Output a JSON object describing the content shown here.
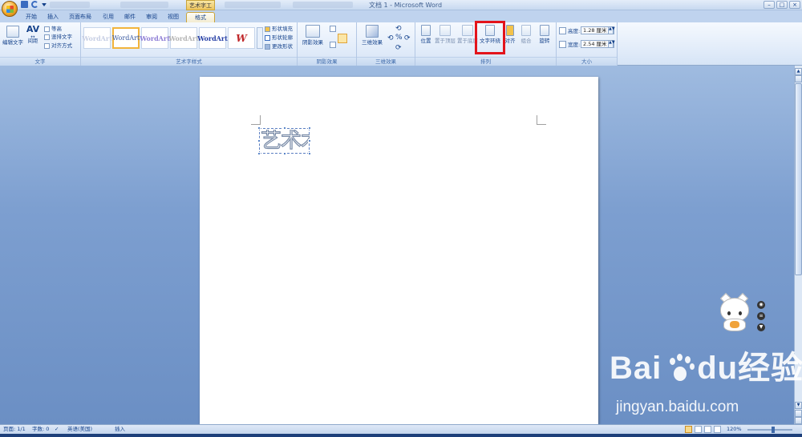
{
  "window": {
    "title": "文档 1 - Microsoft Word",
    "context_tool": "艺术字工具",
    "controls": [
      "–",
      "□",
      "×"
    ]
  },
  "tabs": [
    "开始",
    "插入",
    "页面布局",
    "引用",
    "邮件",
    "审阅",
    "视图",
    "格式"
  ],
  "active_tab": "格式",
  "ribbon": {
    "text_group": {
      "label": "文字",
      "edit_text": "编辑文字",
      "spacing": "间距",
      "equal_height": "等高",
      "vertical_text": "竖排文字",
      "align": "对齐方式"
    },
    "wordart_styles_group": {
      "label": "艺术字样式",
      "gallery": [
        {
          "text": "WordArt",
          "color": "#c7cfe4"
        },
        {
          "text": "WordArt",
          "color": "#3a5aa0"
        },
        {
          "text": "WordArt",
          "color": "#8f7fd6"
        },
        {
          "text": "WordArt",
          "color": "#b5b5b5"
        },
        {
          "text": "WordArt",
          "color": "#2740a6"
        },
        {
          "text": "W",
          "color": "#c0282a"
        }
      ],
      "shape_fill": "形状填充",
      "shape_outline": "形状轮廓",
      "change_shape": "更改形状"
    },
    "shadow_group": {
      "label": "阴影效果",
      "shadow_effect": "阴影效果"
    },
    "threed_group": {
      "label": "三维效果",
      "threed_effect": "三维效果"
    },
    "arrange_group": {
      "label": "排列",
      "position": "位置",
      "bring_front": "置于顶层",
      "send_back": "置于底层",
      "text_wrap": "文字环绕",
      "align": "对齐",
      "group": "组合",
      "rotate": "旋转"
    },
    "size_group": {
      "label": "大小",
      "height_label": "高度:",
      "height_value": "1.28 厘米",
      "width_label": "宽度:",
      "width_value": "2.54 厘米"
    }
  },
  "document": {
    "wordart_text": "艺术术"
  },
  "status": {
    "page": "页面: 1/1",
    "words": "字数: 0",
    "language": "英语(美国)",
    "mode": "插入",
    "zoom": "120%"
  },
  "watermark": {
    "brand": "Bai du 经验",
    "url": "jingyan.baidu.com"
  }
}
